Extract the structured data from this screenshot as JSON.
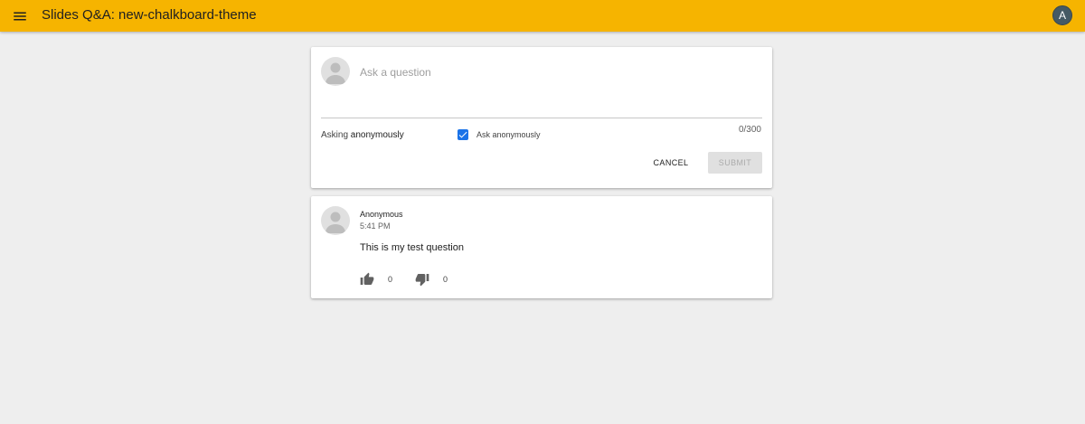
{
  "header": {
    "title": "Slides Q&A: new-chalkboard-theme",
    "account_initial": "A",
    "bar_color": "#f6b400"
  },
  "ask_form": {
    "placeholder": "Ask a question",
    "value": "",
    "char_count": "0/300",
    "asking_prefix": "Asking",
    "asking_mode": "anonymously",
    "anonymous_checkbox_label": "Ask anonymously",
    "anonymous_checked": true,
    "cancel_label": "CANCEL",
    "submit_label": "SUBMIT",
    "submit_enabled": false
  },
  "questions": [
    {
      "author": "Anonymous",
      "time": "5:41 PM",
      "text": "This is my test question",
      "upvotes": "0",
      "downvotes": "0"
    }
  ],
  "icons": {
    "menu": "menu-icon",
    "avatar": "person-icon",
    "check": "check-icon",
    "upvote": "thumb-up-icon",
    "downvote": "thumb-down-icon"
  },
  "colors": {
    "accent": "#f6b400",
    "checkbox": "#1a73e8",
    "background": "#eeeeee"
  }
}
